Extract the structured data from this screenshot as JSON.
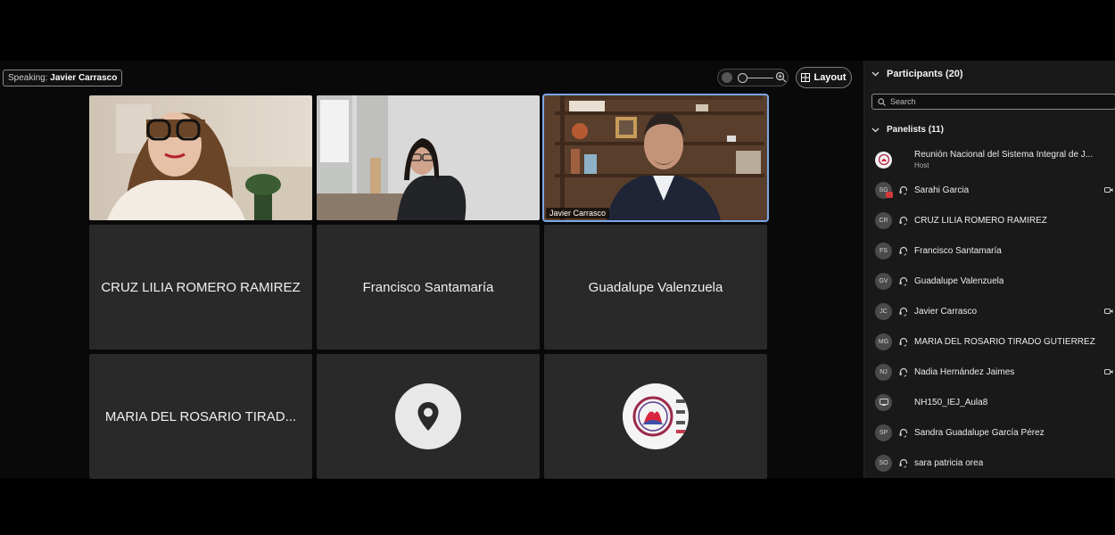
{
  "meeting": {
    "speaking_label": "Speaking:",
    "speaking_name": "Javier Carrasco",
    "layout_label": "Layout"
  },
  "tiles": {
    "video_name_tag": "Javier Carrasco",
    "cruz": "CRUZ LILIA ROMERO RAMIREZ",
    "francisco": "Francisco Santamaría",
    "guadalupe": "Guadalupe Valenzuela",
    "maria": "MARIA DEL ROSARIO TIRAD..."
  },
  "panel": {
    "participants_title": "Participants (20)",
    "search_placeholder": "Search",
    "panelists_title": "Panelists (11)",
    "participants": [
      {
        "initials": "",
        "name": "Reunión Nacional del Sistema Integral de J...",
        "role": "Host"
      },
      {
        "initials": "SG",
        "name": "Sarahi Garcia"
      },
      {
        "initials": "CR",
        "name": "CRUZ LILIA ROMERO RAMIREZ"
      },
      {
        "initials": "FS",
        "name": "Francisco Santamaría"
      },
      {
        "initials": "GV",
        "name": "Guadalupe Valenzuela"
      },
      {
        "initials": "JC",
        "name": "Javier Carrasco"
      },
      {
        "initials": "MG",
        "name": "MARIA DEL ROSARIO TIRADO GUTIERREZ"
      },
      {
        "initials": "NJ",
        "name": "Nadia Hernández Jaimes"
      },
      {
        "initials": "",
        "name": "NH150_IEJ_Aula8"
      },
      {
        "initials": "SP",
        "name": "Sandra Guadalupe García Pérez"
      },
      {
        "initials": "SO",
        "name": "sara patricia orea"
      }
    ]
  },
  "colors": {
    "active_speaker_outline": "#7aa7e8",
    "tile_background": "#292929",
    "panel_background": "#191919"
  }
}
